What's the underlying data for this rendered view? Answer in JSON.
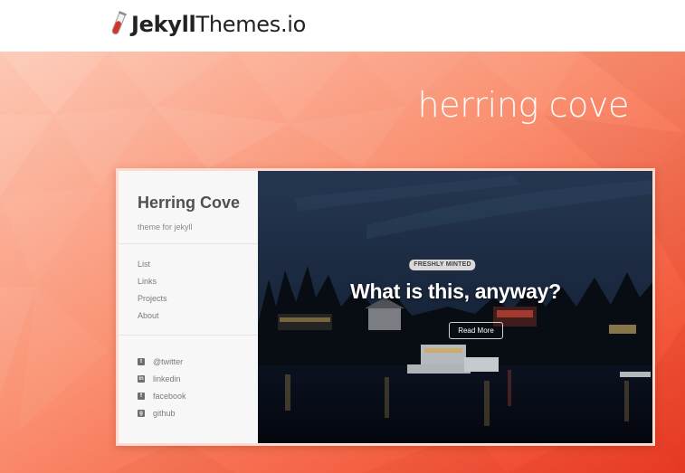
{
  "site": {
    "logo_bold": "Jekyll",
    "logo_regular": "Themes.io",
    "logo_icon": "test-tube-icon"
  },
  "hero": {
    "title": "herring cove",
    "background_colors": [
      "#fbc7b3",
      "#fa8a6c",
      "#f25234",
      "#ec3b25"
    ]
  },
  "preview": {
    "sidebar": {
      "title": "Herring Cove",
      "tagline": "theme for jekyll",
      "nav": [
        "List",
        "Links",
        "Projects",
        "About"
      ],
      "social": [
        {
          "label": "@twitter",
          "icon": "twitter-icon",
          "glyph": "t"
        },
        {
          "label": "linkedin",
          "icon": "linkedin-icon",
          "glyph": "in"
        },
        {
          "label": "facebook",
          "icon": "facebook-icon",
          "glyph": "f"
        },
        {
          "label": "github",
          "icon": "github-icon",
          "glyph": "g"
        }
      ]
    },
    "post": {
      "badge": "FRESHLY MINTED",
      "title": "What is this, anyway?",
      "button": "Read More"
    }
  }
}
